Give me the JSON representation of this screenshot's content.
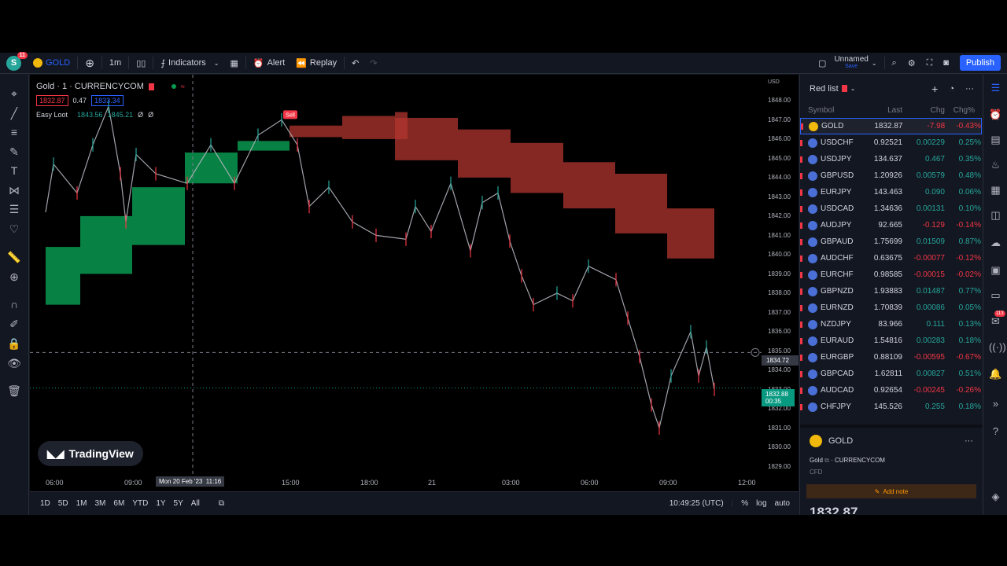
{
  "header": {
    "avatar_letter": "S",
    "avatar_badge": "11",
    "symbol": "GOLD",
    "interval": "1m",
    "indicators": "Indicators",
    "alert": "Alert",
    "replay": "Replay",
    "layout_name": "Unnamed",
    "layout_status": "Save",
    "publish": "Publish"
  },
  "legend": {
    "title": "Gold · 1 · CURRENCYCOM",
    "bid": "1832.87",
    "spread": "0.47",
    "ask": "1833.34",
    "indicator_name": "Easy Loot",
    "ind_val1": "1843.56",
    "ind_val2": "1845.21",
    "ind_val3": "Ø",
    "ind_val4": "Ø"
  },
  "sell_label": "Sell",
  "logo_text": "TradingView",
  "price_axis": {
    "currency": "USD",
    "ticks": [
      "1848.00",
      "1847.00",
      "1846.00",
      "1845.00",
      "1844.00",
      "1843.00",
      "1842.00",
      "1841.00",
      "1840.00",
      "1839.00",
      "1838.00",
      "1837.00",
      "1836.00",
      "1835.00",
      "1834.00",
      "1833.00",
      "1832.00",
      "1831.00",
      "1830.00",
      "1829.00"
    ],
    "crosshair_price": "1834.72",
    "last_price": "1832.88",
    "countdown": "00:35"
  },
  "time_axis": {
    "ticks": [
      "06:00",
      "09:00",
      "15:00",
      "18:00",
      "21",
      "03:00",
      "06:00",
      "09:00",
      "12:00"
    ],
    "crosshair_label": "Mon 20 Feb '23  11:16"
  },
  "bottom_bar": {
    "ranges": [
      "1D",
      "5D",
      "1M",
      "3M",
      "6M",
      "YTD",
      "1Y",
      "5Y",
      "All"
    ],
    "clock": "10:49:25 (UTC)",
    "pct": "%",
    "log": "log",
    "auto": "auto"
  },
  "watchlist": {
    "name": "Red list",
    "cols": {
      "symbol": "Symbol",
      "last": "Last",
      "chg": "Chg",
      "pct": "Chg%"
    },
    "rows": [
      {
        "sym": "GOLD",
        "last": "1832.87",
        "chg": "-7.98",
        "pct": "-0.43%",
        "dir": "neg",
        "color": "#f0b90b"
      },
      {
        "sym": "USDCHF",
        "last": "0.92521",
        "chg": "0.00229",
        "pct": "0.25%",
        "dir": "pos",
        "color": "#4a6fd6"
      },
      {
        "sym": "USDJPY",
        "last": "134.637",
        "chg": "0.467",
        "pct": "0.35%",
        "dir": "pos",
        "color": "#4a6fd6"
      },
      {
        "sym": "GBPUSD",
        "last": "1.20926",
        "chg": "0.00579",
        "pct": "0.48%",
        "dir": "pos",
        "color": "#4a6fd6"
      },
      {
        "sym": "EURJPY",
        "last": "143.463",
        "chg": "0.090",
        "pct": "0.06%",
        "dir": "pos",
        "color": "#4a6fd6"
      },
      {
        "sym": "USDCAD",
        "last": "1.34636",
        "chg": "0.00131",
        "pct": "0.10%",
        "dir": "pos",
        "color": "#4a6fd6"
      },
      {
        "sym": "AUDJPY",
        "last": "92.665",
        "chg": "-0.129",
        "pct": "-0.14%",
        "dir": "neg",
        "color": "#4a6fd6"
      },
      {
        "sym": "GBPAUD",
        "last": "1.75699",
        "chg": "0.01509",
        "pct": "0.87%",
        "dir": "pos",
        "color": "#4a6fd6"
      },
      {
        "sym": "AUDCHF",
        "last": "0.63675",
        "chg": "-0.00077",
        "pct": "-0.12%",
        "dir": "neg",
        "color": "#4a6fd6"
      },
      {
        "sym": "EURCHF",
        "last": "0.98585",
        "chg": "-0.00015",
        "pct": "-0.02%",
        "dir": "neg",
        "color": "#4a6fd6"
      },
      {
        "sym": "GBPNZD",
        "last": "1.93883",
        "chg": "0.01487",
        "pct": "0.77%",
        "dir": "pos",
        "color": "#4a6fd6"
      },
      {
        "sym": "EURNZD",
        "last": "1.70839",
        "chg": "0.00086",
        "pct": "0.05%",
        "dir": "pos",
        "color": "#4a6fd6"
      },
      {
        "sym": "NZDJPY",
        "last": "83.966",
        "chg": "0.111",
        "pct": "0.13%",
        "dir": "pos",
        "color": "#4a6fd6"
      },
      {
        "sym": "EURAUD",
        "last": "1.54816",
        "chg": "0.00283",
        "pct": "0.18%",
        "dir": "pos",
        "color": "#4a6fd6"
      },
      {
        "sym": "EURGBP",
        "last": "0.88109",
        "chg": "-0.00595",
        "pct": "-0.67%",
        "dir": "neg",
        "color": "#4a6fd6"
      },
      {
        "sym": "GBPCAD",
        "last": "1.62811",
        "chg": "0.00827",
        "pct": "0.51%",
        "dir": "pos",
        "color": "#4a6fd6"
      },
      {
        "sym": "AUDCAD",
        "last": "0.92654",
        "chg": "-0.00245",
        "pct": "-0.26%",
        "dir": "neg",
        "color": "#4a6fd6"
      },
      {
        "sym": "CHFJPY",
        "last": "145.526",
        "chg": "0.255",
        "pct": "0.18%",
        "dir": "pos",
        "color": "#4a6fd6"
      }
    ]
  },
  "details": {
    "symbol": "GOLD",
    "description": "Gold",
    "exchange": "CURRENCYCOM",
    "type": "CFD",
    "add_note": "Add note",
    "price": "1832.87"
  },
  "right_badge": "113",
  "colors": {
    "up": "#26a69a",
    "down": "#f23645",
    "accent": "#2962ff",
    "zone_green": "#089950",
    "zone_red": "#b2362f"
  }
}
